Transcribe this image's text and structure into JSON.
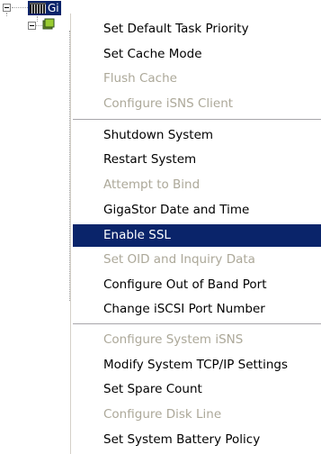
{
  "tree": {
    "root_label": "Gi"
  },
  "menu": {
    "items": [
      {
        "label": "Set Default Task Priority",
        "disabled": false
      },
      {
        "label": "Set Cache Mode",
        "disabled": false
      },
      {
        "label": "Flush Cache",
        "disabled": true
      },
      {
        "label": "Configure iSNS Client",
        "disabled": true
      },
      {
        "label": "Shutdown System",
        "disabled": false
      },
      {
        "label": "Restart System",
        "disabled": false
      },
      {
        "label": "Attempt to Bind",
        "disabled": true
      },
      {
        "label": "GigaStor Date and Time",
        "disabled": false
      },
      {
        "label": "Enable SSL",
        "disabled": false,
        "selected": true
      },
      {
        "label": "Set OID and Inquiry Data",
        "disabled": true
      },
      {
        "label": "Configure Out of Band Port",
        "disabled": false
      },
      {
        "label": "Change iSCSI Port Number",
        "disabled": false
      },
      {
        "label": "Configure System iSNS",
        "disabled": true
      },
      {
        "label": "Modify System TCP/IP Settings",
        "disabled": false
      },
      {
        "label": "Set Spare Count",
        "disabled": false
      },
      {
        "label": "Configure Disk Line",
        "disabled": true
      },
      {
        "label": "Set System Battery Policy",
        "disabled": false
      }
    ]
  },
  "colors": {
    "selection": "#0a246a",
    "disabled_text": "#aca899"
  }
}
